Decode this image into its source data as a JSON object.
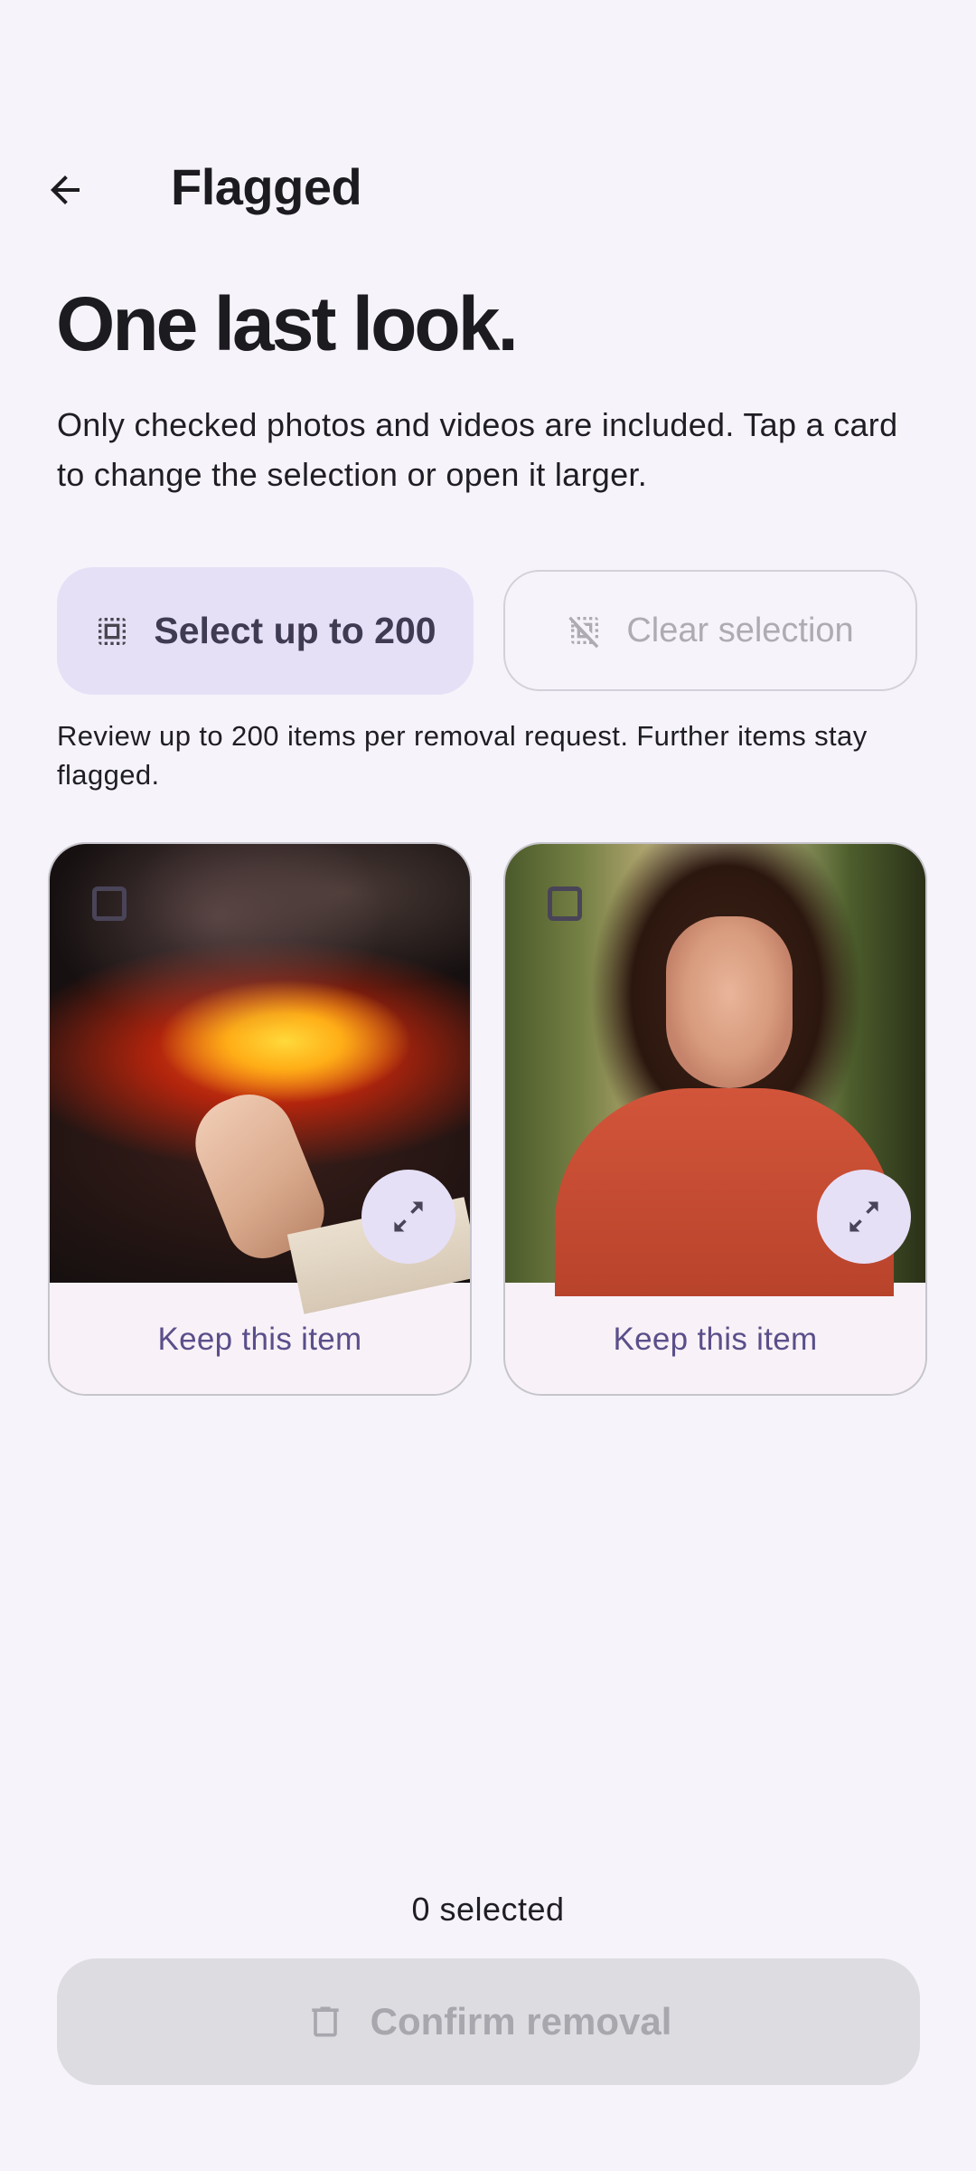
{
  "header": {
    "back_icon": "arrow-back-icon",
    "title": "Flagged"
  },
  "headline": "One last look.",
  "description": "Only checked photos and videos are included. Tap a card to change the selection or open it larger.",
  "actions": {
    "select_label": "Select up to 200",
    "select_icon": "select-all-icon",
    "clear_label": "Clear selection",
    "clear_icon": "deselect-icon",
    "clear_enabled": false
  },
  "note": "Review up to 200 items per removal request. Further items stay flagged.",
  "items": [
    {
      "thumbnail": "lava-hand-photo",
      "checked": false,
      "expand_icon": "expand-icon",
      "keep_label": "Keep this item"
    },
    {
      "thumbnail": "smiling-woman-photo",
      "checked": false,
      "expand_icon": "expand-icon",
      "keep_label": "Keep this item"
    }
  ],
  "footer": {
    "selected_count": "0 selected",
    "confirm_label": "Confirm removal",
    "confirm_icon": "trash-icon",
    "confirm_enabled": false
  },
  "colors": {
    "background": "#f6f4fa",
    "accent_container": "#e6e0f7",
    "accent_text": "#5a4f8a",
    "disabled_button": "#dddce1",
    "disabled_text": "#a9a7ae"
  }
}
